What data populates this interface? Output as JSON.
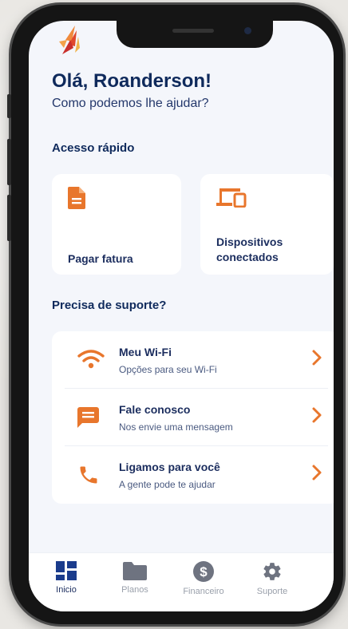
{
  "greeting": {
    "title": "Olá, Roanderson!",
    "subtitle": "Como podemos lhe ajudar?"
  },
  "quick_access": {
    "title": "Acesso rápido",
    "cards": [
      {
        "label": "Pagar fatura",
        "icon": "document-icon"
      },
      {
        "label_line1": "Dispositivos",
        "label_line2": "conectados",
        "icon": "devices-icon"
      }
    ]
  },
  "support": {
    "title": "Precisa de suporte?",
    "items": [
      {
        "title": "Meu Wi-Fi",
        "subtitle": "Opções para seu Wi-Fi",
        "icon": "wifi-icon"
      },
      {
        "title": "Fale conosco",
        "subtitle": "Nos envie uma mensagem",
        "icon": "chat-icon"
      },
      {
        "title": "Ligamos para você",
        "subtitle": "A gente pode te ajudar",
        "icon": "phone-icon"
      }
    ]
  },
  "tabbar": {
    "items": [
      {
        "label": "Inicio",
        "icon": "dashboard-icon",
        "active": true
      },
      {
        "label": "Planos",
        "icon": "folder-icon",
        "active": false
      },
      {
        "label": "Financeiro",
        "icon": "dollar-icon",
        "active": false
      },
      {
        "label": "Suporte",
        "icon": "gear-icon",
        "active": false
      }
    ]
  },
  "colors": {
    "accent": "#e8762c",
    "primary_text": "#0f2a5c",
    "background": "#f4f6fb",
    "active_tab": "#1b3c8c",
    "inactive_tab": "#9aa0ab"
  }
}
